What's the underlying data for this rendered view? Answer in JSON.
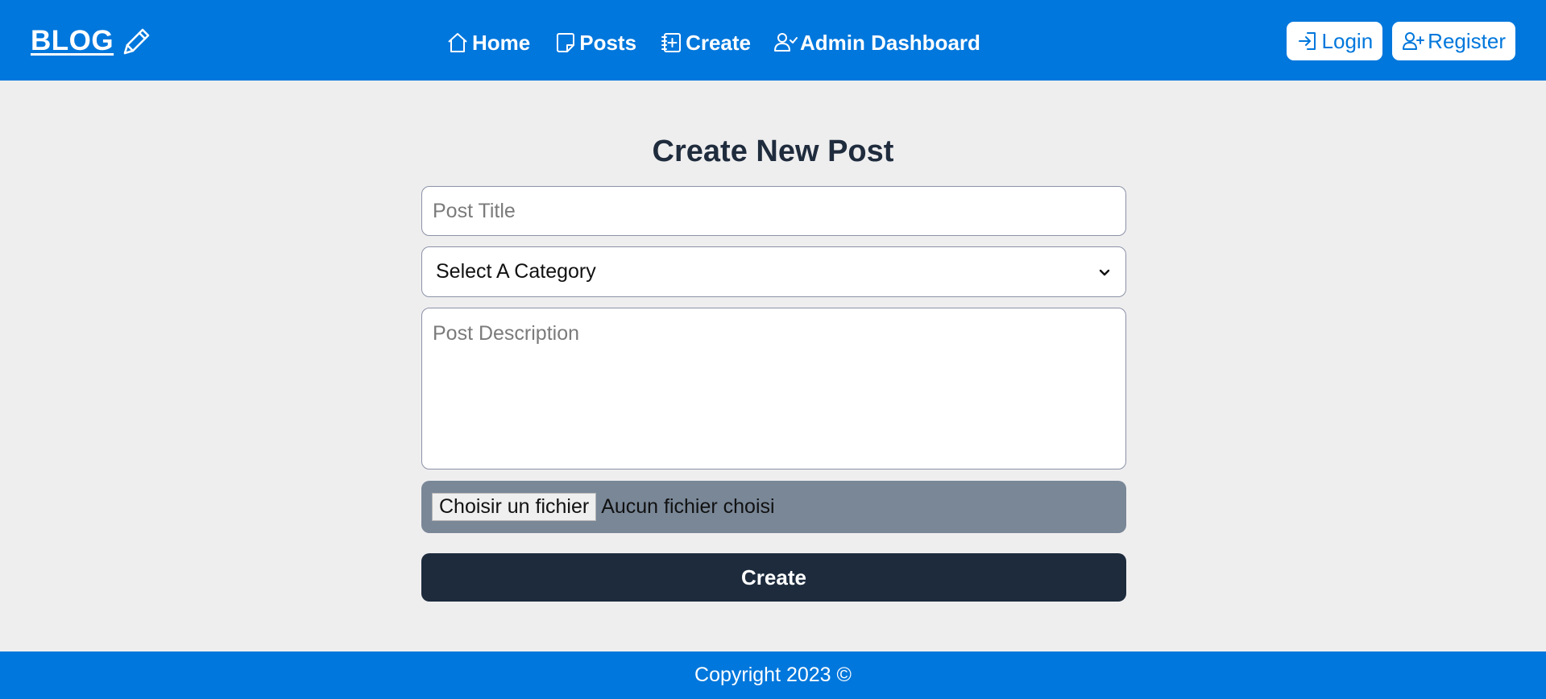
{
  "colors": {
    "primary": "#0077dc",
    "background": "#efeeef",
    "dark": "#1d2b3d",
    "file_input_bg": "#798797",
    "title": "#1f2c3d"
  },
  "header": {
    "logo_text": "BLOG",
    "logo_icon": "pencil-icon",
    "nav": [
      {
        "label": "Home",
        "icon": "home-icon"
      },
      {
        "label": "Posts",
        "icon": "posts-icon"
      },
      {
        "label": "Create",
        "icon": "create-icon"
      },
      {
        "label": "Admin Dashboard",
        "icon": "admin-icon"
      }
    ],
    "auth": {
      "login_label": "Login",
      "login_icon": "login-icon",
      "register_label": "Register",
      "register_icon": "register-icon"
    }
  },
  "main": {
    "title": "Create New Post",
    "form": {
      "title_placeholder": "Post Title",
      "category_selected": "Select A Category",
      "description_placeholder": "Post Description",
      "file_button_label": "Choisir un fichier",
      "file_status": "Aucun fichier choisi",
      "submit_label": "Create"
    }
  },
  "footer": {
    "text": "Copyright 2023 ©"
  }
}
